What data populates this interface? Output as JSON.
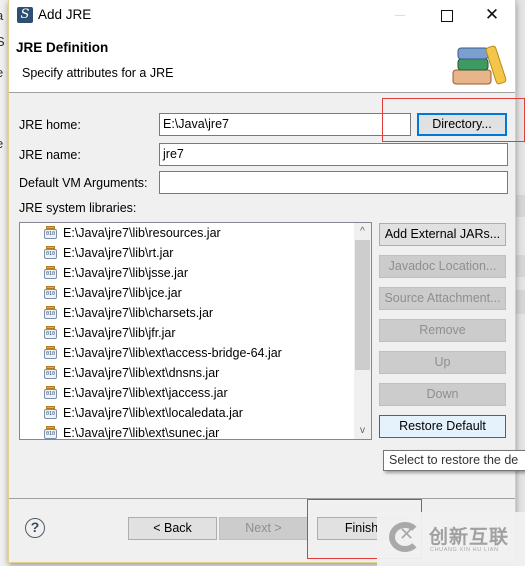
{
  "window": {
    "title": "Add JRE",
    "app_icon_glyph": "S",
    "minimize_label": "",
    "maximize_label": "",
    "close_label": "✕"
  },
  "background": {
    "left_fragments": [
      "a",
      "S",
      "e",
      "t",
      "e"
    ]
  },
  "header": {
    "title": "JRE Definition",
    "description": "Specify attributes for a JRE",
    "icon": "books-icon"
  },
  "form": {
    "jre_home": {
      "label": "JRE home:",
      "value": "E:\\Java\\jre7"
    },
    "jre_name": {
      "label": "JRE name:",
      "value": "jre7"
    },
    "vm_args": {
      "label": "Default VM Arguments:",
      "value": ""
    },
    "directory_button": "Directory..."
  },
  "libraries": {
    "label": "JRE system libraries:",
    "items": [
      "E:\\Java\\jre7\\lib\\resources.jar",
      "E:\\Java\\jre7\\lib\\rt.jar",
      "E:\\Java\\jre7\\lib\\jsse.jar",
      "E:\\Java\\jre7\\lib\\jce.jar",
      "E:\\Java\\jre7\\lib\\charsets.jar",
      "E:\\Java\\jre7\\lib\\jfr.jar",
      "E:\\Java\\jre7\\lib\\ext\\access-bridge-64.jar",
      "E:\\Java\\jre7\\lib\\ext\\dnsns.jar",
      "E:\\Java\\jre7\\lib\\ext\\jaccess.jar",
      "E:\\Java\\jre7\\lib\\ext\\localedata.jar",
      "E:\\Java\\jre7\\lib\\ext\\sunec.jar"
    ],
    "jar_icon_text": "010",
    "scroll_up": "^",
    "scroll_down": "v"
  },
  "side_buttons": {
    "add_external_jars": "Add External JARs...",
    "javadoc_location": "Javadoc Location...",
    "source_attachment": "Source Attachment...",
    "remove": "Remove",
    "up": "Up",
    "down": "Down",
    "restore_default": "Restore Default"
  },
  "tooltip": "Select to restore the de",
  "footer": {
    "help": "?",
    "back": "< Back",
    "next": "Next >",
    "finish": "Finish"
  },
  "watermark": {
    "text": "创新互联",
    "subtext": "CHUANG XIN HU LIAN"
  },
  "colors": {
    "accent_focus": "#0078d7",
    "annotation_red": "#e03c3c",
    "disabled_text": "#8f8f8f"
  }
}
